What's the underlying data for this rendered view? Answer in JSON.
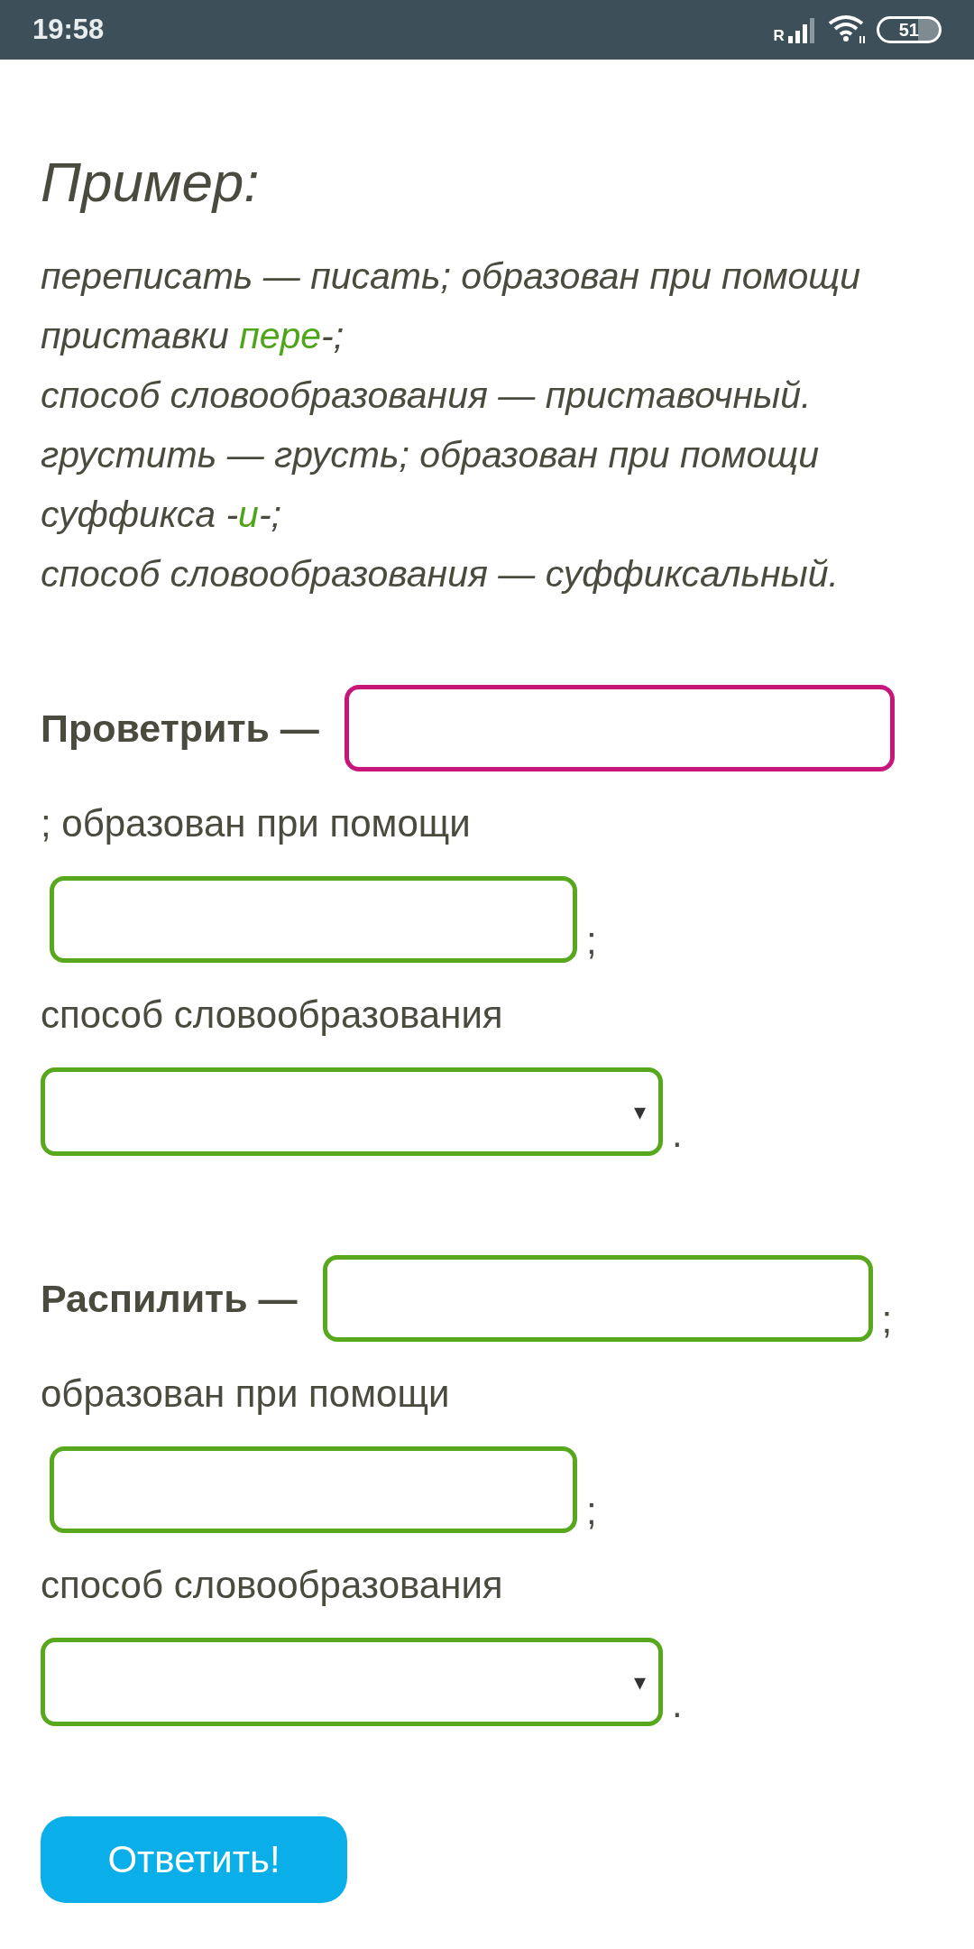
{
  "status_bar": {
    "time": "19:58",
    "roaming": "R",
    "battery": "51"
  },
  "example": {
    "title": "Пример:",
    "sentences": [
      [
        {
          "text": "переписать — писать; образован при помощи\nприставки ",
          "highlight": false
        },
        {
          "text": "пере",
          "highlight": true
        },
        {
          "text": "-;\nспособ словообразования — приставочный.",
          "highlight": false
        }
      ],
      [
        {
          "text": "грустить — грусть; образован при помощи\nсуффикса -",
          "highlight": false
        },
        {
          "text": "и",
          "highlight": true
        },
        {
          "text": "-;\nспособ словообразования — суффиксальный.",
          "highlight": false
        }
      ]
    ]
  },
  "exercises": [
    {
      "rows": [
        [
          {
            "kind": "word",
            "text": "Проветрить —"
          },
          {
            "kind": "field",
            "focused": true
          }
        ],
        [
          {
            "kind": "text",
            "text": "; образован при помощи"
          }
        ],
        [
          {
            "kind": "field",
            "focused": false
          },
          {
            "kind": "text",
            "text": ";"
          }
        ],
        [
          {
            "kind": "text",
            "text": "способ словообразования"
          }
        ],
        [
          {
            "kind": "select",
            "focused": false
          },
          {
            "kind": "text",
            "text": "."
          }
        ]
      ]
    },
    {
      "rows": [
        [
          {
            "kind": "word",
            "text": "Распилить —"
          },
          {
            "kind": "field",
            "focused": false
          },
          {
            "kind": "text",
            "text": ";"
          }
        ],
        [
          {
            "kind": "text",
            "text": "образован при помощи"
          }
        ],
        [
          {
            "kind": "field",
            "focused": false
          },
          {
            "kind": "text",
            "text": ";"
          }
        ],
        [
          {
            "kind": "text",
            "text": "способ словообразования"
          }
        ],
        [
          {
            "kind": "select",
            "focused": false
          },
          {
            "kind": "text",
            "text": "."
          }
        ]
      ]
    }
  ],
  "select_arrow": "▾",
  "submit": {
    "label": "Ответить!"
  }
}
